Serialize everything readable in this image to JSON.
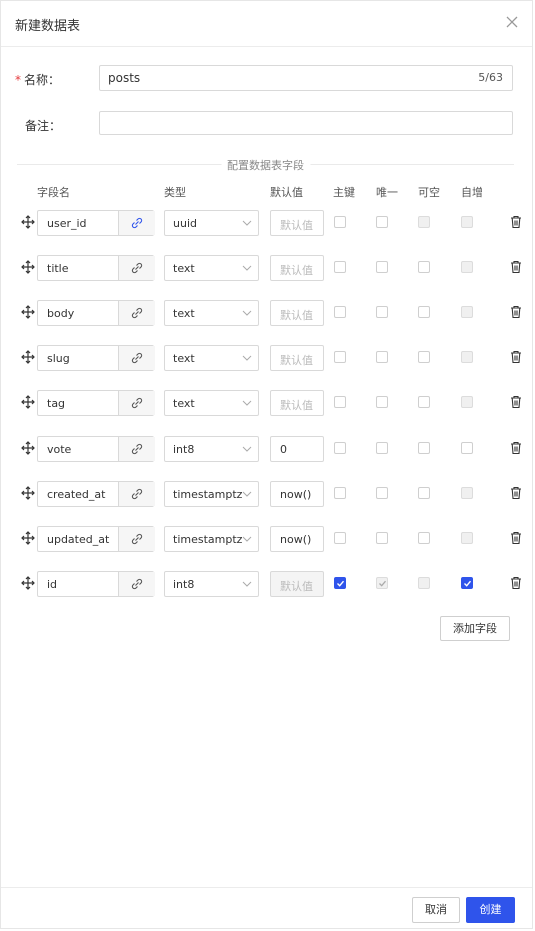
{
  "dialog": {
    "title": "新建数据表"
  },
  "form": {
    "name_label": "名称：",
    "name_required_mark": "*",
    "name_value": "posts",
    "name_count": "5/63",
    "remark_label": "备注：",
    "remark_value": ""
  },
  "section_title": "配置数据表字段",
  "columns": {
    "name": "字段名",
    "type": "类型",
    "default": "默认值",
    "primary": "主键",
    "unique": "唯一",
    "nullable": "可空",
    "auto": "自增"
  },
  "default_placeholder": "默认值",
  "fields": [
    {
      "name": "user_id",
      "type": "uuid",
      "default": "",
      "primary": false,
      "unique": false,
      "nullable": false,
      "auto": false,
      "link_active": true,
      "default_disabled": false,
      "unique_disabled": false,
      "nullable_disabled": true,
      "auto_disabled": true
    },
    {
      "name": "title",
      "type": "text",
      "default": "",
      "primary": false,
      "unique": false,
      "nullable": false,
      "auto": false,
      "link_active": false,
      "default_disabled": false,
      "unique_disabled": false,
      "nullable_disabled": false,
      "auto_disabled": true
    },
    {
      "name": "body",
      "type": "text",
      "default": "",
      "primary": false,
      "unique": false,
      "nullable": false,
      "auto": false,
      "link_active": false,
      "default_disabled": false,
      "unique_disabled": false,
      "nullable_disabled": false,
      "auto_disabled": true
    },
    {
      "name": "slug",
      "type": "text",
      "default": "",
      "primary": false,
      "unique": false,
      "nullable": false,
      "auto": false,
      "link_active": false,
      "default_disabled": false,
      "unique_disabled": false,
      "nullable_disabled": false,
      "auto_disabled": true
    },
    {
      "name": "tag",
      "type": "text",
      "default": "",
      "primary": false,
      "unique": false,
      "nullable": false,
      "auto": false,
      "link_active": false,
      "default_disabled": false,
      "unique_disabled": false,
      "nullable_disabled": false,
      "auto_disabled": true
    },
    {
      "name": "vote",
      "type": "int8",
      "default": "0",
      "primary": false,
      "unique": false,
      "nullable": false,
      "auto": false,
      "link_active": false,
      "default_disabled": false,
      "unique_disabled": false,
      "nullable_disabled": false,
      "auto_disabled": false
    },
    {
      "name": "created_at",
      "type": "timestamptz",
      "default": "now()",
      "primary": false,
      "unique": false,
      "nullable": false,
      "auto": false,
      "link_active": false,
      "default_disabled": false,
      "unique_disabled": false,
      "nullable_disabled": false,
      "auto_disabled": true
    },
    {
      "name": "updated_at",
      "type": "timestamptz",
      "default": "now()",
      "primary": false,
      "unique": false,
      "nullable": false,
      "auto": false,
      "link_active": false,
      "default_disabled": false,
      "unique_disabled": false,
      "nullable_disabled": false,
      "auto_disabled": true
    },
    {
      "name": "id",
      "type": "int8",
      "default": "",
      "primary": true,
      "unique": true,
      "nullable": false,
      "auto": true,
      "link_active": false,
      "default_disabled": true,
      "unique_disabled": true,
      "nullable_disabled": true,
      "auto_disabled": false
    }
  ],
  "add_field_label": "添加字段",
  "footer": {
    "cancel_label": "取消",
    "ok_label": "创建"
  },
  "colors": {
    "accent": "#2f54eb",
    "link_active": "#2f54eb",
    "link_inactive": "#555555"
  },
  "icons": [
    "close-icon",
    "drag-handle-icon",
    "link-icon",
    "chevron-down-icon",
    "trash-icon",
    "check-icon"
  ]
}
